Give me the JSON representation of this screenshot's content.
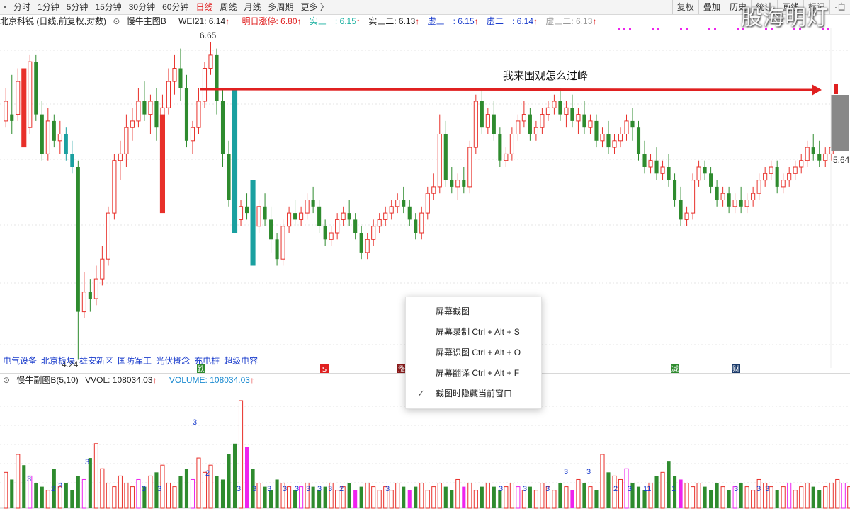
{
  "toolbar": {
    "periods": [
      "分时",
      "1分钟",
      "5分钟",
      "15分钟",
      "30分钟",
      "60分钟",
      "日线",
      "周线",
      "月线",
      "多周期",
      "更多 〉"
    ],
    "active_period": "日线",
    "right_buttons": [
      "复权",
      "叠加",
      "历史",
      "统计",
      "画线",
      "标记",
      "·自"
    ]
  },
  "watermark": "股海明灯",
  "info_bar": {
    "stock": "北京科锐 (日线,前复权,对数)",
    "indicator": "慢牛主图B",
    "wei21": "WEI21: 6.14",
    "limit_up": "明日涨停: 6.80",
    "shi_san_yi": "实三一: 6.15",
    "shi_san_er": "实三二: 6.13",
    "xu_san_yi": "虚三一: 6.15",
    "xu_er_yi": "虚二一: 6.14",
    "xu_san_er": "虚三二: 6.13",
    "arrow": "↑"
  },
  "colors": {
    "up": "#e8302a",
    "down": "#2e8b2e",
    "magenta": "#ee22ee",
    "teal": "#1aa0a0",
    "blue_text": "#1a3ccc",
    "limit_red": "#e02020",
    "gray": "#888888"
  },
  "price_high_label": "6.65",
  "price_low_label": "4.24",
  "price_right_label": "5.64",
  "annotation": "我来围观怎么过峰",
  "concepts": [
    "电气设备",
    "北京板块",
    "雄安新区",
    "国防军工",
    "光伏概念",
    "充电桩",
    "超级电容"
  ],
  "event_markers": [
    "跌",
    "S",
    "涨",
    "减",
    "财"
  ],
  "sub_panel": {
    "title": "慢牛副图B(5,10)",
    "vvol": "VVOL: 108034.03",
    "volume": "VOLUME: 108034.03",
    "arrow": "↑",
    "volume_numbers": [
      "3",
      "2",
      "3",
      "3",
      "3",
      "3",
      "3",
      "2",
      "3",
      "3",
      "3",
      "3",
      "3",
      "3",
      "3",
      "3",
      "2",
      "3",
      "3",
      "3",
      "3",
      "3",
      "3",
      "2",
      "3",
      "11",
      "1",
      "3",
      "3",
      "3"
    ]
  },
  "context_menu": {
    "items": [
      {
        "label": "屏幕截图",
        "checked": false
      },
      {
        "label": "屏幕录制 Ctrl + Alt + S",
        "checked": false
      },
      {
        "label": "屏幕识图 Ctrl + Alt + O",
        "checked": false
      },
      {
        "label": "屏幕翻译 Ctrl + Alt + F",
        "checked": false
      },
      {
        "label": "截图时隐藏当前窗口",
        "checked": true
      }
    ],
    "check_icon": "checkmark-icon"
  },
  "chart_data": {
    "type": "candlestick",
    "note_series": "daily candles, values are prices (relative), read approximately from image",
    "y_range": [
      4.2,
      6.7
    ],
    "candles": [
      [
        6.2,
        6.3,
        6.05,
        6.0,
        1
      ],
      [
        6.05,
        6.4,
        6.1,
        5.95,
        0
      ],
      [
        6.1,
        6.45,
        6.35,
        6.05,
        1
      ],
      [
        6.35,
        6.4,
        6.0,
        5.95,
        0
      ],
      [
        6.0,
        6.55,
        6.5,
        5.95,
        1
      ],
      [
        6.5,
        6.55,
        6.1,
        6.05,
        0
      ],
      [
        6.1,
        6.2,
        5.8,
        5.75,
        0
      ],
      [
        5.8,
        6.15,
        6.05,
        5.75,
        1
      ],
      [
        6.05,
        6.1,
        5.9,
        5.85,
        0
      ],
      [
        5.9,
        6.05,
        5.95,
        5.8,
        1
      ],
      [
        5.95,
        6.0,
        5.8,
        5.75,
        0
      ],
      [
        5.8,
        5.9,
        5.7,
        5.65,
        0
      ],
      [
        5.7,
        5.75,
        4.6,
        4.24,
        0
      ],
      [
        4.6,
        4.9,
        4.75,
        4.55,
        1
      ],
      [
        4.75,
        4.85,
        4.7,
        4.6,
        0
      ],
      [
        4.7,
        4.95,
        4.85,
        4.65,
        1
      ],
      [
        4.85,
        5.1,
        5.0,
        4.8,
        1
      ],
      [
        5.0,
        5.4,
        5.35,
        4.95,
        1
      ],
      [
        5.35,
        5.8,
        5.75,
        5.3,
        1
      ],
      [
        5.75,
        5.9,
        5.8,
        5.6,
        1
      ],
      [
        5.8,
        6.1,
        6.0,
        5.7,
        1
      ],
      [
        6.0,
        6.15,
        6.05,
        5.9,
        1
      ],
      [
        6.05,
        6.3,
        6.2,
        6.0,
        1
      ],
      [
        6.2,
        6.35,
        6.1,
        6.05,
        0
      ],
      [
        6.1,
        6.25,
        6.2,
        5.95,
        1
      ],
      [
        6.2,
        6.3,
        6.0,
        5.9,
        0
      ],
      [
        6.0,
        6.25,
        6.15,
        5.9,
        1
      ],
      [
        6.15,
        6.45,
        6.35,
        6.1,
        1
      ],
      [
        6.35,
        6.55,
        6.45,
        6.25,
        1
      ],
      [
        6.45,
        6.6,
        6.3,
        6.2,
        0
      ],
      [
        6.3,
        6.4,
        5.9,
        5.85,
        0
      ],
      [
        5.9,
        6.05,
        6.0,
        5.8,
        1
      ],
      [
        6.0,
        6.3,
        6.2,
        5.95,
        1
      ],
      [
        6.2,
        6.5,
        6.45,
        6.15,
        1
      ],
      [
        6.45,
        6.65,
        6.55,
        6.4,
        1
      ],
      [
        6.55,
        6.6,
        6.2,
        6.1,
        0
      ],
      [
        6.2,
        6.3,
        5.8,
        5.7,
        0
      ],
      [
        5.8,
        5.9,
        5.45,
        5.4,
        0
      ],
      [
        5.45,
        5.55,
        5.3,
        5.2,
        0
      ],
      [
        5.3,
        5.45,
        5.4,
        5.25,
        1
      ],
      [
        5.4,
        5.5,
        5.35,
        5.3,
        0
      ],
      [
        5.35,
        5.45,
        5.25,
        5.2,
        0
      ],
      [
        5.25,
        5.45,
        5.4,
        5.2,
        1
      ],
      [
        5.4,
        5.5,
        5.3,
        5.25,
        0
      ],
      [
        5.3,
        5.4,
        5.15,
        5.05,
        0
      ],
      [
        5.15,
        5.2,
        5.0,
        4.95,
        0
      ],
      [
        5.0,
        5.3,
        5.25,
        4.95,
        1
      ],
      [
        5.25,
        5.4,
        5.35,
        5.2,
        1
      ],
      [
        5.35,
        5.45,
        5.3,
        5.25,
        0
      ],
      [
        5.3,
        5.4,
        5.35,
        5.25,
        1
      ],
      [
        5.35,
        5.5,
        5.45,
        5.3,
        1
      ],
      [
        5.45,
        5.55,
        5.4,
        5.35,
        0
      ],
      [
        5.4,
        5.45,
        5.25,
        5.2,
        0
      ],
      [
        5.25,
        5.3,
        5.15,
        5.1,
        0
      ],
      [
        5.15,
        5.25,
        5.2,
        5.1,
        1
      ],
      [
        5.2,
        5.35,
        5.3,
        5.15,
        1
      ],
      [
        5.3,
        5.4,
        5.35,
        5.25,
        1
      ],
      [
        5.35,
        5.45,
        5.3,
        5.25,
        0
      ],
      [
        5.3,
        5.35,
        5.2,
        5.15,
        0
      ],
      [
        5.2,
        5.25,
        5.05,
        5.0,
        0
      ],
      [
        5.05,
        5.2,
        5.15,
        5.0,
        1
      ],
      [
        5.15,
        5.3,
        5.25,
        5.1,
        1
      ],
      [
        5.25,
        5.35,
        5.3,
        5.2,
        1
      ],
      [
        5.3,
        5.4,
        5.35,
        5.25,
        1
      ],
      [
        5.35,
        5.45,
        5.4,
        5.3,
        1
      ],
      [
        5.4,
        5.5,
        5.45,
        5.35,
        1
      ],
      [
        5.45,
        5.55,
        5.4,
        5.35,
        0
      ],
      [
        5.4,
        5.45,
        5.3,
        5.25,
        0
      ],
      [
        5.3,
        5.35,
        5.2,
        5.15,
        0
      ],
      [
        5.2,
        5.4,
        5.35,
        5.15,
        1
      ],
      [
        5.35,
        5.55,
        5.5,
        5.3,
        1
      ],
      [
        5.5,
        5.65,
        5.55,
        5.45,
        1
      ],
      [
        5.55,
        6.1,
        5.95,
        5.5,
        1
      ],
      [
        5.95,
        6.05,
        5.6,
        5.55,
        0
      ],
      [
        5.6,
        5.7,
        5.55,
        5.5,
        0
      ],
      [
        5.55,
        5.65,
        5.6,
        5.45,
        1
      ],
      [
        5.6,
        5.7,
        5.55,
        5.5,
        0
      ],
      [
        5.55,
        5.9,
        5.85,
        5.5,
        1
      ],
      [
        5.85,
        6.25,
        6.2,
        5.8,
        1
      ],
      [
        6.2,
        6.3,
        6.0,
        5.95,
        0
      ],
      [
        6.0,
        6.15,
        6.1,
        5.95,
        1
      ],
      [
        6.1,
        6.2,
        5.95,
        5.9,
        0
      ],
      [
        5.95,
        6.0,
        5.75,
        5.7,
        0
      ],
      [
        5.75,
        5.85,
        5.8,
        5.7,
        1
      ],
      [
        5.8,
        6.0,
        5.95,
        5.75,
        1
      ],
      [
        5.95,
        6.1,
        6.05,
        5.9,
        1
      ],
      [
        6.05,
        6.2,
        6.1,
        6.0,
        1
      ],
      [
        6.1,
        6.15,
        5.95,
        5.9,
        0
      ],
      [
        5.95,
        6.05,
        6.0,
        5.9,
        1
      ],
      [
        6.0,
        6.15,
        6.1,
        5.95,
        1
      ],
      [
        6.1,
        6.2,
        6.15,
        6.05,
        1
      ],
      [
        6.15,
        6.25,
        6.2,
        6.1,
        1
      ],
      [
        6.2,
        6.3,
        6.1,
        6.05,
        0
      ],
      [
        6.1,
        6.2,
        6.15,
        6.0,
        1
      ],
      [
        6.15,
        6.25,
        6.05,
        6.0,
        0
      ],
      [
        6.05,
        6.15,
        6.1,
        5.95,
        1
      ],
      [
        6.1,
        6.2,
        6.0,
        5.95,
        0
      ],
      [
        6.0,
        6.1,
        6.05,
        5.95,
        1
      ],
      [
        6.05,
        6.1,
        5.9,
        5.85,
        0
      ],
      [
        5.9,
        6.0,
        5.95,
        5.85,
        1
      ],
      [
        5.95,
        6.05,
        5.85,
        5.8,
        0
      ],
      [
        5.85,
        5.95,
        5.9,
        5.8,
        1
      ],
      [
        5.9,
        6.0,
        5.95,
        5.85,
        1
      ],
      [
        5.95,
        6.1,
        6.05,
        5.9,
        1
      ],
      [
        6.05,
        6.15,
        6.0,
        5.9,
        0
      ],
      [
        6.0,
        6.05,
        5.8,
        5.75,
        0
      ],
      [
        5.8,
        5.9,
        5.7,
        5.65,
        0
      ],
      [
        5.7,
        5.8,
        5.75,
        5.65,
        1
      ],
      [
        5.75,
        5.85,
        5.65,
        5.6,
        0
      ],
      [
        5.65,
        5.75,
        5.7,
        5.6,
        1
      ],
      [
        5.7,
        5.8,
        5.6,
        5.55,
        0
      ],
      [
        5.6,
        5.65,
        5.45,
        5.4,
        0
      ],
      [
        5.45,
        5.55,
        5.3,
        5.25,
        0
      ],
      [
        5.3,
        5.4,
        5.35,
        5.25,
        1
      ],
      [
        5.35,
        5.65,
        5.6,
        5.3,
        1
      ],
      [
        5.6,
        5.75,
        5.7,
        5.55,
        1
      ],
      [
        5.7,
        5.75,
        5.65,
        5.6,
        0
      ],
      [
        5.65,
        5.7,
        5.55,
        5.5,
        0
      ],
      [
        5.55,
        5.6,
        5.45,
        5.4,
        0
      ],
      [
        5.45,
        5.55,
        5.5,
        5.4,
        1
      ],
      [
        5.5,
        5.55,
        5.4,
        5.35,
        0
      ],
      [
        5.4,
        5.5,
        5.45,
        5.35,
        1
      ],
      [
        5.45,
        5.55,
        5.4,
        5.35,
        0
      ],
      [
        5.4,
        5.5,
        5.45,
        5.35,
        1
      ],
      [
        5.45,
        5.55,
        5.5,
        5.4,
        1
      ],
      [
        5.5,
        5.65,
        5.6,
        5.45,
        1
      ],
      [
        5.6,
        5.7,
        5.65,
        5.55,
        1
      ],
      [
        5.65,
        5.75,
        5.7,
        5.6,
        1
      ],
      [
        5.7,
        5.75,
        5.55,
        5.5,
        0
      ],
      [
        5.55,
        5.65,
        5.6,
        5.5,
        1
      ],
      [
        5.6,
        5.7,
        5.65,
        5.55,
        1
      ],
      [
        5.65,
        5.75,
        5.7,
        5.6,
        1
      ],
      [
        5.7,
        5.8,
        5.75,
        5.65,
        1
      ],
      [
        5.75,
        5.9,
        5.85,
        5.7,
        1
      ],
      [
        5.85,
        5.95,
        5.8,
        5.75,
        0
      ],
      [
        5.8,
        5.9,
        5.75,
        5.7,
        0
      ],
      [
        5.75,
        5.85,
        5.8,
        5.7,
        1
      ],
      [
        5.8,
        5.9,
        5.85,
        5.75,
        1
      ]
    ],
    "volumes": [
      20,
      16,
      30,
      24,
      18,
      14,
      12,
      10,
      22,
      12,
      14,
      10,
      18,
      16,
      28,
      36,
      22,
      14,
      12,
      18,
      14,
      12,
      16,
      12,
      18,
      20,
      24,
      14,
      12,
      18,
      22,
      16,
      28,
      20,
      24,
      18,
      16,
      30,
      36,
      60,
      34,
      22,
      14,
      12,
      10,
      16,
      14,
      12,
      10,
      12,
      14,
      12,
      10,
      12,
      14,
      10,
      12,
      14,
      10,
      12,
      14,
      12,
      10,
      12,
      10,
      14,
      12,
      10,
      12,
      14,
      10,
      12,
      14,
      12,
      10,
      16,
      12,
      14,
      10,
      12,
      14,
      12,
      10,
      12,
      14,
      12,
      10,
      12,
      10,
      14,
      12,
      10,
      14,
      12,
      10,
      16,
      14,
      12,
      10,
      30,
      20,
      18,
      16,
      22,
      14,
      12,
      10,
      14,
      18,
      20,
      26,
      18,
      16,
      14,
      12,
      14,
      12,
      10,
      14,
      12,
      10,
      12,
      14,
      12,
      10,
      16,
      14,
      12,
      10,
      12,
      14,
      10,
      12,
      14,
      12,
      10,
      12,
      14,
      16,
      14,
      12,
      10,
      12,
      14,
      12,
      10,
      16,
      14
    ],
    "volume_scale_max": 60
  }
}
